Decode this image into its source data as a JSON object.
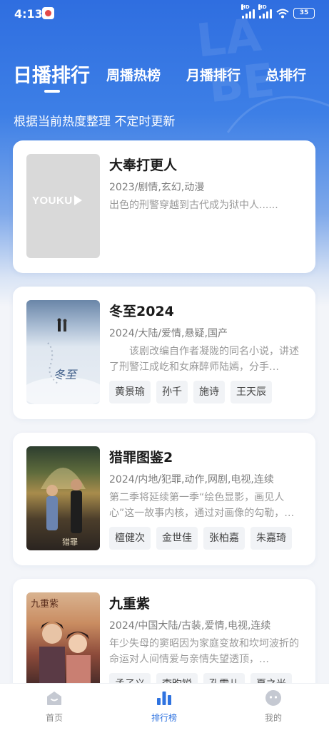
{
  "status_bar": {
    "time": "4:13",
    "battery": "35",
    "network_label": "HD"
  },
  "tabs": [
    {
      "label": "日播排行",
      "active": true
    },
    {
      "label": "周播热榜",
      "active": false
    },
    {
      "label": "月播排行",
      "active": false
    },
    {
      "label": "总排行",
      "active": false
    }
  ],
  "subtitle": "根据当前热度整理 不定时更新",
  "shows": [
    {
      "title": "大奉打更人",
      "meta": "2023/剧情,玄幻,动漫",
      "desc": "出色的刑警穿越到古代成为狱中人......",
      "poster_label": "YOUKU",
      "cast": []
    },
    {
      "title": "冬至2024",
      "meta": "2024/大陆/爱情,悬疑,国产",
      "desc": "　　该剧改编自作者凝陇的同名小说，讲述了刑警江成屹和女麻醉师陆嫣，分手…",
      "cast": [
        "黄景瑜",
        "孙千",
        "施诗",
        "王天辰"
      ]
    },
    {
      "title": "猎罪图鉴2",
      "meta": "2024/内地/犯罪,动作,网剧,电视,连续",
      "desc": "第二季将延续第一季“绘色显影，画见人心”这一故事内核，通过对画像的勾勒，…",
      "cast": [
        "檀健次",
        "金世佳",
        "张柏嘉",
        "朱嘉琦"
      ]
    },
    {
      "title": "九重紫",
      "meta": "2024/中国大陆/古装,爱情,电视,连续",
      "desc": "年少失母的窦昭因为家庭变故和坎坷波折的命运对人间情爱与亲情失望透顶，…",
      "cast": [
        "孟子义",
        "李昀锐",
        "孔雪儿",
        "夏之光"
      ]
    }
  ],
  "bottom_nav": [
    {
      "label": "首页",
      "icon": "home-icon",
      "active": false
    },
    {
      "label": "排行榜",
      "icon": "chart-icon",
      "active": true
    },
    {
      "label": "我的",
      "icon": "profile-icon",
      "active": false
    }
  ],
  "colors": {
    "accent": "#2f73e0",
    "header_blue": "#2f6ee0"
  }
}
